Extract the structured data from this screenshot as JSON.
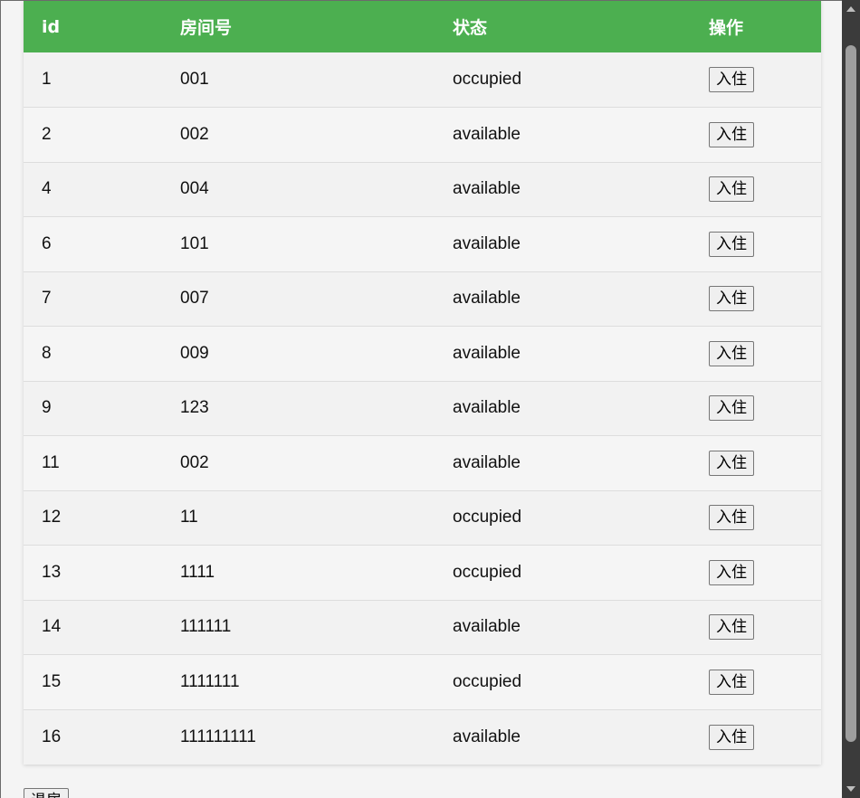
{
  "table": {
    "headers": {
      "id": "id",
      "room": "房间号",
      "status": "状态",
      "action": "操作"
    },
    "rows": [
      {
        "id": "1",
        "room": "001",
        "status": "occupied",
        "action": "入住"
      },
      {
        "id": "2",
        "room": "002",
        "status": "available",
        "action": "入住"
      },
      {
        "id": "4",
        "room": "004",
        "status": "available",
        "action": "入住"
      },
      {
        "id": "6",
        "room": "101",
        "status": "available",
        "action": "入住"
      },
      {
        "id": "7",
        "room": "007",
        "status": "available",
        "action": "入住"
      },
      {
        "id": "8",
        "room": "009",
        "status": "available",
        "action": "入住"
      },
      {
        "id": "9",
        "room": "123",
        "status": "available",
        "action": "入住"
      },
      {
        "id": "11",
        "room": "002",
        "status": "available",
        "action": "入住"
      },
      {
        "id": "12",
        "room": "11",
        "status": "occupied",
        "action": "入住"
      },
      {
        "id": "13",
        "room": "1111",
        "status": "occupied",
        "action": "入住"
      },
      {
        "id": "14",
        "room": "111111",
        "status": "available",
        "action": "入住"
      },
      {
        "id": "15",
        "room": "1111111",
        "status": "occupied",
        "action": "入住"
      },
      {
        "id": "16",
        "room": "111111111",
        "status": "available",
        "action": "入住"
      }
    ]
  },
  "bottom_button": {
    "label": "退房"
  },
  "colors": {
    "header_bg": "#4caf50",
    "header_text": "#ffffff",
    "row_odd": "#f2f2f2",
    "row_even": "#f5f5f5"
  }
}
